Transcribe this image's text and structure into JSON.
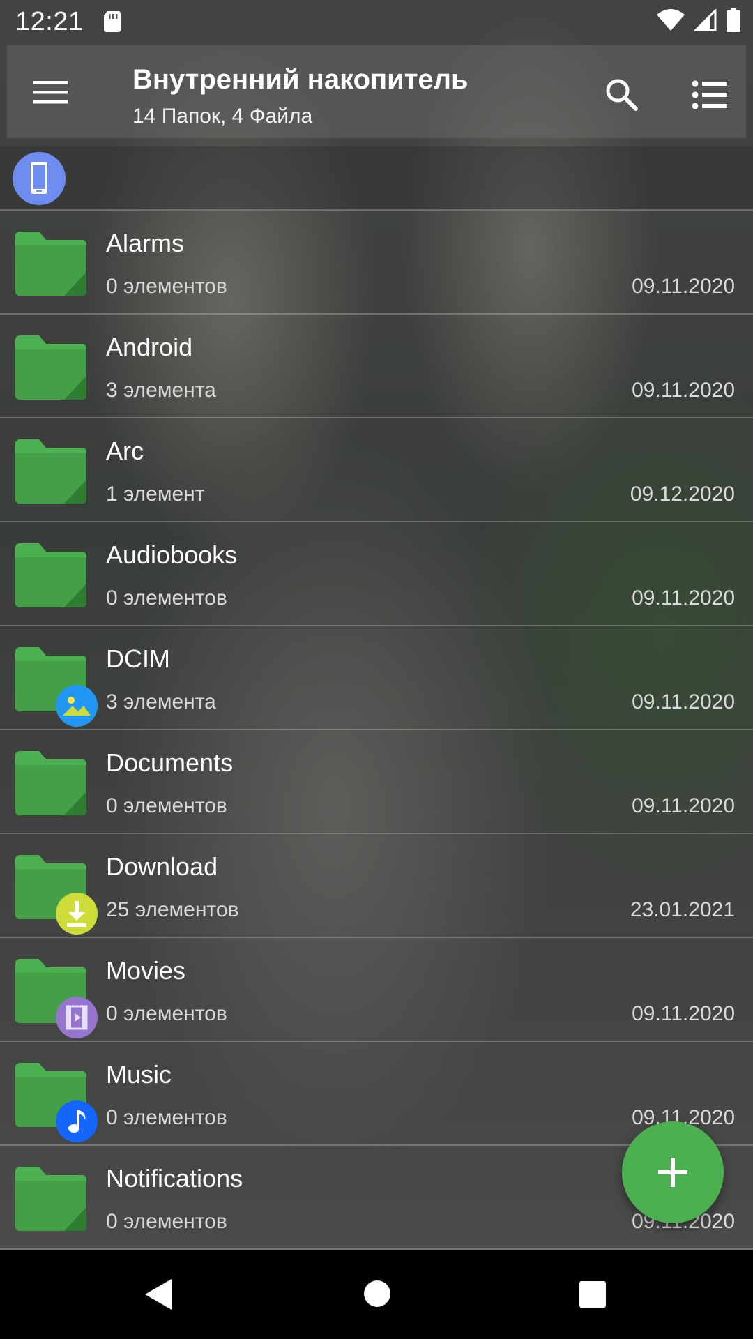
{
  "status_bar": {
    "time": "12:21"
  },
  "appbar": {
    "title": "Внутренний накопитель",
    "subtitle": "14 Папок, 4 Файла"
  },
  "colors": {
    "folder": "#4caf50",
    "fab": "#4caf50",
    "device_chip": "#6f8df0",
    "dcim_badge": "#2196f3",
    "download_badge": "#cddc39",
    "movies_badge": "#9575cd",
    "music_badge": "#1565ff"
  },
  "folders": [
    {
      "name": "Alarms",
      "count": "0 элементов",
      "date": "09.11.2020",
      "badge": ""
    },
    {
      "name": "Android",
      "count": "3 элемента",
      "date": "09.11.2020",
      "badge": ""
    },
    {
      "name": "Arc",
      "count": "1 элемент",
      "date": "09.12.2020",
      "badge": ""
    },
    {
      "name": "Audiobooks",
      "count": "0 элементов",
      "date": "09.11.2020",
      "badge": ""
    },
    {
      "name": "DCIM",
      "count": "3 элемента",
      "date": "09.11.2020",
      "badge": "image-icon"
    },
    {
      "name": "Documents",
      "count": "0 элементов",
      "date": "09.11.2020",
      "badge": ""
    },
    {
      "name": "Download",
      "count": "25 элементов",
      "date": "23.01.2021",
      "badge": "download-icon"
    },
    {
      "name": "Movies",
      "count": "0 элементов",
      "date": "09.11.2020",
      "badge": "film-icon"
    },
    {
      "name": "Music",
      "count": "0 элементов",
      "date": "09.11.2020",
      "badge": "music-note-icon"
    },
    {
      "name": "Notifications",
      "count": "0 элементов",
      "date": "09.11.2020",
      "badge": ""
    }
  ]
}
